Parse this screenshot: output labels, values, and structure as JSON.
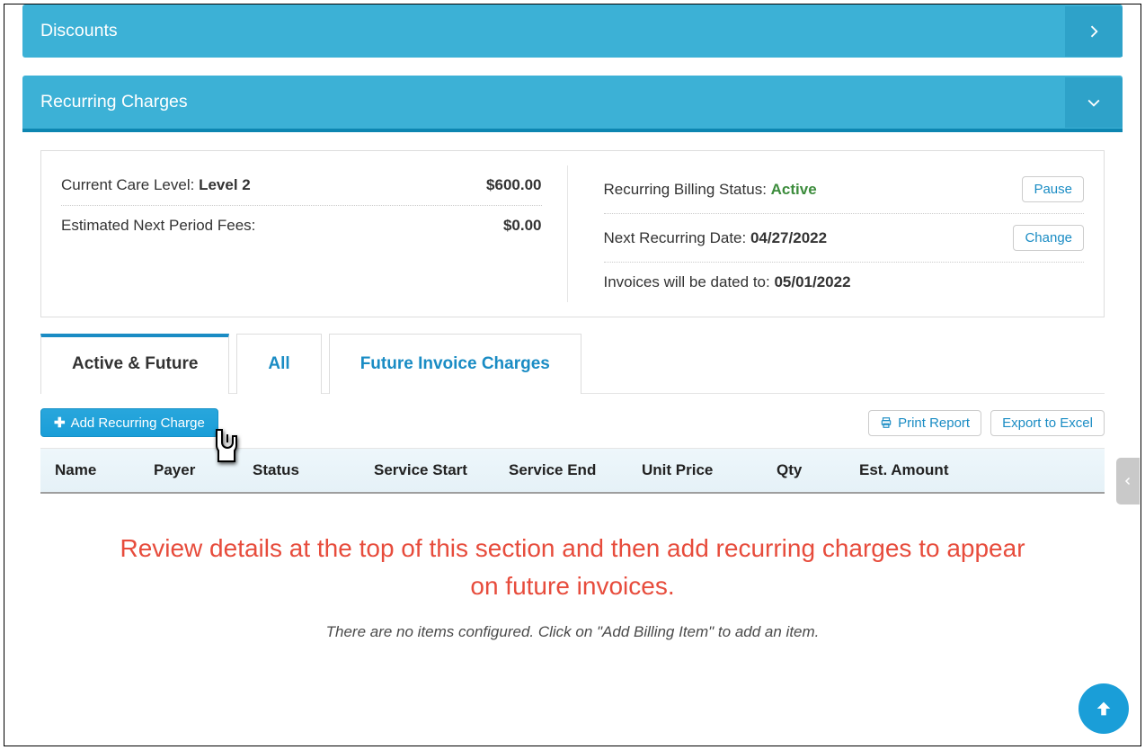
{
  "discounts": {
    "title": "Discounts"
  },
  "recurring": {
    "title": "Recurring Charges",
    "summary_left": {
      "care_level_label": "Current Care Level:",
      "care_level_value": "Level 2",
      "care_level_amount": "$600.00",
      "est_fees_label": "Estimated Next Period Fees:",
      "est_fees_amount": "$0.00"
    },
    "summary_right": {
      "status_label": "Recurring Billing Status:",
      "status_value": "Active",
      "pause_label": "Pause",
      "next_date_label": "Next Recurring Date:",
      "next_date_value": "04/27/2022",
      "change_label": "Change",
      "invoice_date_label": "Invoices will be dated to:",
      "invoice_date_value": "05/01/2022"
    },
    "tabs": {
      "active_future": "Active & Future",
      "all": "All",
      "future_invoice": "Future Invoice Charges"
    },
    "actions": {
      "add": "Add Recurring Charge",
      "print": "Print Report",
      "excel": "Export to Excel"
    },
    "columns": {
      "name": "Name",
      "payer": "Payer",
      "status": "Status",
      "service_start": "Service Start",
      "service_end": "Service End",
      "unit_price": "Unit Price",
      "qty": "Qty",
      "est_amount": "Est. Amount"
    },
    "callout": "Review details at the top of this section and then add recurring charges to appear on future invoices.",
    "no_items": "There are no items configured. Click on \"Add Billing Item\" to add an item."
  }
}
